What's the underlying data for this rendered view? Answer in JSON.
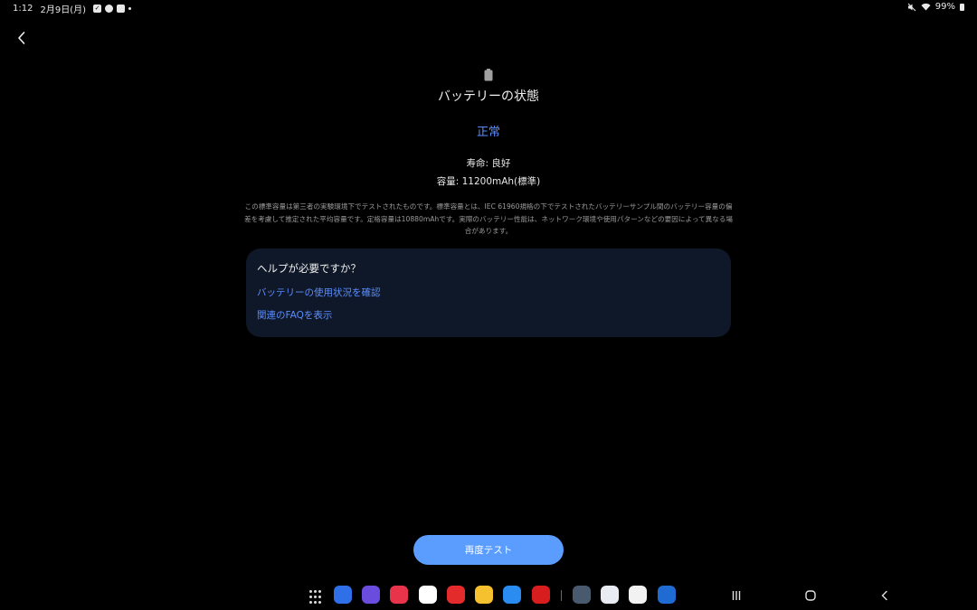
{
  "status_bar": {
    "time": "1:12",
    "date": "2月9日(月)",
    "battery": "99%"
  },
  "header": {
    "title": "バッテリーの状態",
    "status": "正常",
    "life": "寿命: 良好",
    "capacity": "容量: 11200mAh(標準)"
  },
  "disclaimer": "この標準容量は第三者の実験環境下でテストされたものです。標準容量とは、IEC 61960規格の下でテストされたバッテリーサンプル間のバッテリー容量の偏差を考慮して推定された平均容量です。定格容量は10880mAhです。実際のバッテリー性能は、ネットワーク環境や使用パターンなどの要因によって異なる場合があります。",
  "help": {
    "title": "ヘルプが必要ですか？",
    "links": [
      "バッテリーの使用状況を確認",
      "関連のFAQを表示"
    ]
  },
  "retest_button": "再度テスト",
  "taskbar_apps": [
    {
      "name": "messages-icon",
      "color": "#2f6fe8"
    },
    {
      "name": "internet-icon",
      "color": "#6a4cde"
    },
    {
      "name": "music-icon",
      "color": "#e8344b"
    },
    {
      "name": "drive-icon",
      "color": "#ffffff"
    },
    {
      "name": "flipboard-icon",
      "color": "#e32b2b"
    },
    {
      "name": "files-icon",
      "color": "#f5c12e"
    },
    {
      "name": "pdf-viewer-icon",
      "color": "#2a8cf0"
    },
    {
      "name": "acrobat-icon",
      "color": "#d71d1d"
    },
    {
      "name": "settings-icon",
      "color": "#4a5a6e"
    },
    {
      "name": "onedrive-icon",
      "color": "#e8ecf2"
    },
    {
      "name": "play-store-icon",
      "color": "#f2f2f2"
    },
    {
      "name": "book-icon",
      "color": "#1f6bd1"
    }
  ]
}
